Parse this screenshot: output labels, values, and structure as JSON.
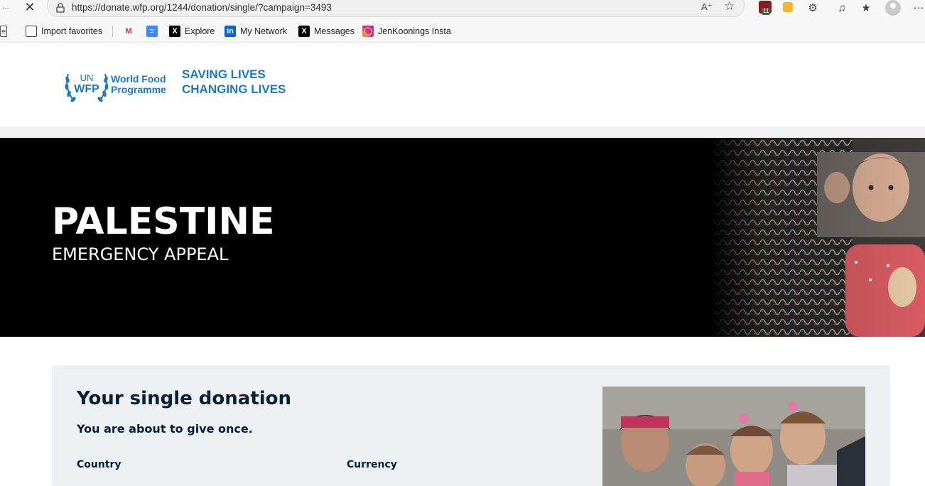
{
  "browser": {
    "url": "https://donate.wfp.org/1244/donation/single/?campaign=3493",
    "extension_badge_count": "11",
    "favorites": [
      {
        "label": "Import favorites",
        "icon": "import-icon"
      },
      {
        "label": "",
        "icon": "gmail-icon"
      },
      {
        "label": "",
        "icon": "docs-icon"
      },
      {
        "label": "Explore",
        "icon": "x-icon"
      },
      {
        "label": "My Network",
        "icon": "linkedin-icon"
      },
      {
        "label": "Messages",
        "icon": "x-icon"
      },
      {
        "label": "JenKoonings Insta",
        "icon": "instagram-icon"
      }
    ]
  },
  "header": {
    "logo_text_un": "UN",
    "logo_text_wfp": "WFP",
    "logo_name_line1": "World Food",
    "logo_name_line2": "Programme",
    "tagline_line1": "SAVING LIVES",
    "tagline_line2": "CHANGING LIVES"
  },
  "hero": {
    "title": "PALESTINE",
    "subtitle": "EMERGENCY APPEAL"
  },
  "donation": {
    "title": "Your single donation",
    "subtitle": "You are about to give once.",
    "country_label": "Country",
    "currency_label": "Currency"
  },
  "colors": {
    "brand_blue": "#1a7ac0",
    "hero_bg": "#000000",
    "panel_bg": "#eef1f4",
    "heading_dark": "#0a1e34"
  }
}
